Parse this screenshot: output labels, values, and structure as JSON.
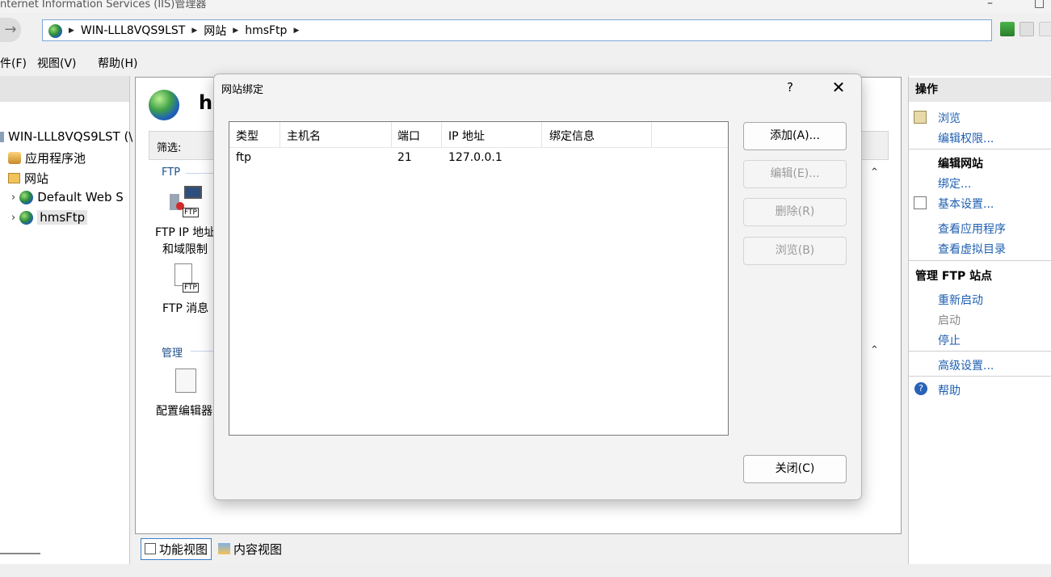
{
  "window": {
    "title": "nternet Information Services (IIS)管理器",
    "minimize": "–",
    "maximize": "□"
  },
  "address": {
    "back": "→",
    "crumbs": [
      "WIN-LLL8VQS9LST",
      "网站",
      "hmsFtp"
    ]
  },
  "menu": [
    "件(F)",
    "视图(V)",
    "帮助(H)"
  ],
  "tree": {
    "server": "WIN-LLL8VQS9LST (\\",
    "app_pools": "应用程序池",
    "sites": "网站",
    "default_site": "Default Web S",
    "selected_site": "hmsFtp"
  },
  "center": {
    "heading_fragment": "hı",
    "filter_label": "筛选:",
    "group_ftp": "FTP",
    "feature_ip_line1": "FTP IP 地址",
    "feature_ip_line2": "和域限制",
    "feature_msg": "FTP 消息",
    "group_manage": "管理",
    "feature_config": "配置编辑器",
    "tab_features": "功能视图",
    "tab_content": "内容视图",
    "ftp_badge": "FTP"
  },
  "actions": {
    "header": "操作",
    "browse": "浏览",
    "edit_perms": "编辑权限...",
    "edit_site_header": "编辑网站",
    "bindings": "绑定...",
    "basic_settings": "基本设置...",
    "view_apps": "查看应用程序",
    "view_vdirs": "查看虚拟目录",
    "manage_ftp_header": "管理 FTP 站点",
    "restart": "重新启动",
    "start": "启动",
    "stop": "停止",
    "advanced": "高级设置...",
    "help": "帮助"
  },
  "dialog": {
    "title": "网站绑定",
    "help": "?",
    "close_x": "✕",
    "columns": [
      "类型",
      "主机名",
      "端口",
      "IP 地址",
      "绑定信息"
    ],
    "rows": [
      {
        "type": "ftp",
        "host": "",
        "port": "21",
        "ip": "127.0.0.1",
        "info": ""
      }
    ],
    "buttons": {
      "add": "添加(A)...",
      "edit": "编辑(E)...",
      "remove": "删除(R)",
      "browse": "浏览(B)",
      "close": "关闭(C)"
    }
  },
  "colors": {
    "link": "#1f5fb0",
    "accent_border": "#3c7fc8"
  }
}
